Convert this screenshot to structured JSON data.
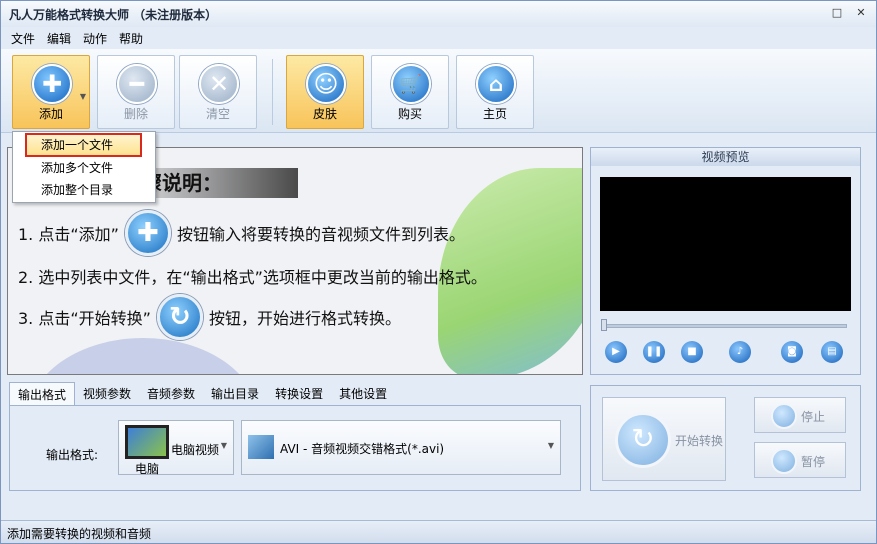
{
  "window": {
    "title": "凡人万能格式转换大师 （未注册版本）",
    "controls": [
      "□",
      "✕"
    ]
  },
  "menu": [
    "文件",
    "编辑",
    "动作",
    "帮助"
  ],
  "toolbar": {
    "add": "添加",
    "delete": "删除",
    "clear": "清空",
    "skin": "皮肤",
    "buy": "购买",
    "home": "主页"
  },
  "dropdown": {
    "items": [
      "添加一个文件",
      "添加多个文件",
      "添加整个目录"
    ]
  },
  "instructions": {
    "heading": "骤说明：",
    "step1_pre": "1. 点击“添加”",
    "step1_post": "按钮输入将要转换的音视频文件到列表。",
    "step2": "2. 选中列表中文件，在“输出格式”选项框中更改当前的输出格式。",
    "step3_pre": "3. 点击“开始转换”",
    "step3_post": "按钮，开始进行格式转换。"
  },
  "preview": {
    "title": "视频预览"
  },
  "tabs": [
    "输出格式",
    "视频参数",
    "音频参数",
    "输出目录",
    "转换设置",
    "其他设置"
  ],
  "output": {
    "label": "输出格式:",
    "device": "电脑视频",
    "device_sub": "电脑",
    "format": "AVI - 音频视频交错格式(*.avi)"
  },
  "convert": {
    "start": "开始转换",
    "stop": "停止",
    "pause": "暂停"
  },
  "status": {
    "text": "添加需要转换的视频和音频"
  }
}
